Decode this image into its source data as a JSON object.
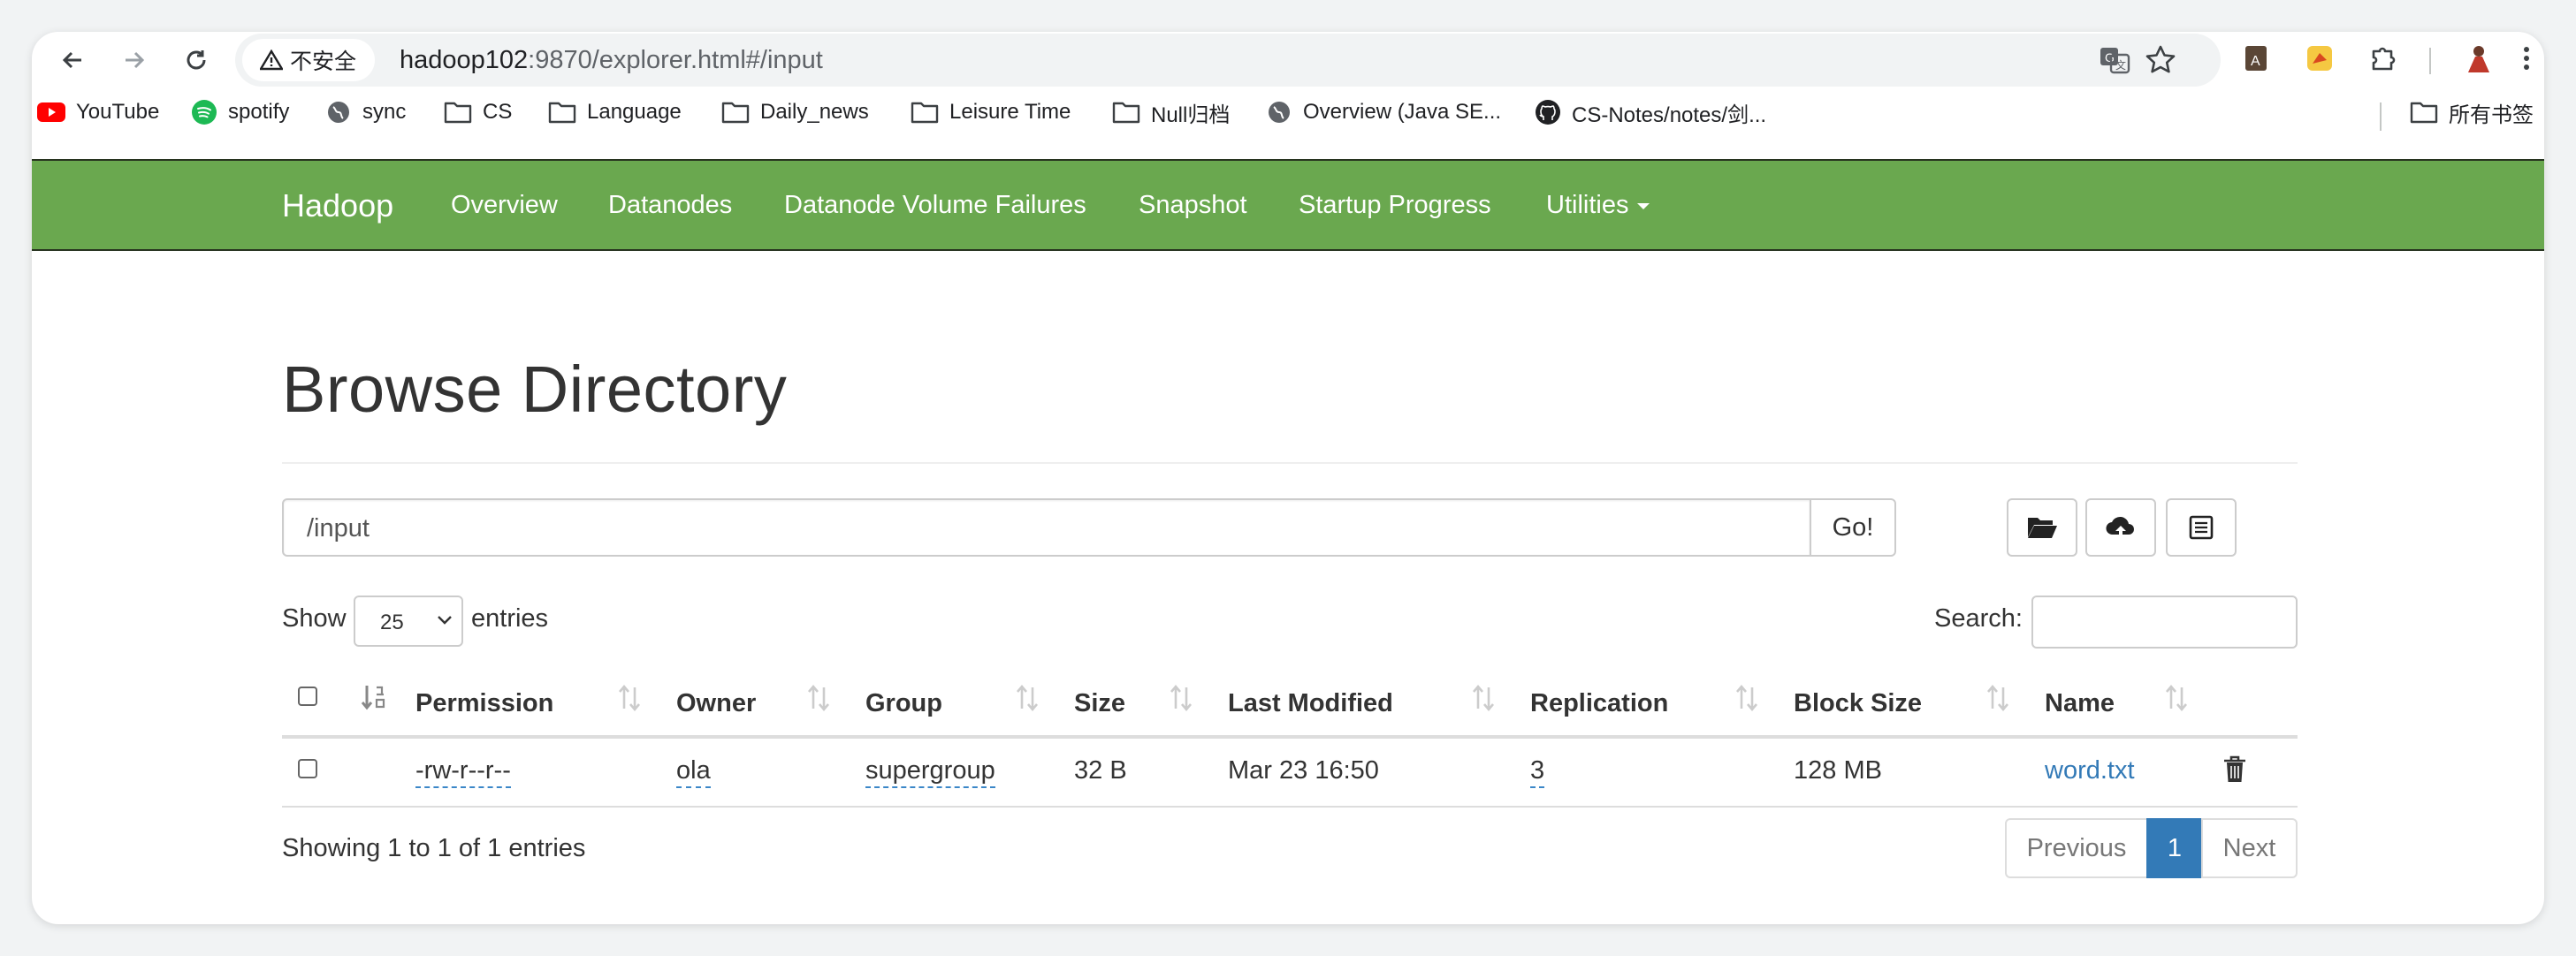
{
  "browser": {
    "security_label": "不安全",
    "url_host": "hadoop102",
    "url_rest": ":9870/explorer.html#/input"
  },
  "bookmarks": [
    {
      "label": "YouTube",
      "icon": "youtube-icon"
    },
    {
      "label": "spotify",
      "icon": "spotify-icon"
    },
    {
      "label": "sync",
      "icon": "globe-icon"
    },
    {
      "label": "CS",
      "icon": "folder-icon"
    },
    {
      "label": "Language",
      "icon": "folder-icon"
    },
    {
      "label": "Daily_news",
      "icon": "folder-icon"
    },
    {
      "label": "Leisure Time",
      "icon": "folder-icon"
    },
    {
      "label": "Null归档",
      "icon": "folder-icon"
    },
    {
      "label": "Overview (Java SE...",
      "icon": "globe-icon"
    },
    {
      "label": "CS-Notes/notes/剑...",
      "icon": "github-icon"
    },
    {
      "label": "所有书签",
      "icon": "folder-icon"
    }
  ],
  "navbar": {
    "brand": "Hadoop",
    "links": [
      "Overview",
      "Datanodes",
      "Datanode Volume Failures",
      "Snapshot",
      "Startup Progress",
      "Utilities"
    ],
    "bg_color": "#6aa84f"
  },
  "main": {
    "title": "Browse Directory",
    "path_value": "/input",
    "go_label": "Go!",
    "show_label": "Show",
    "entries_select": "25",
    "entries_label": "entries",
    "search_label": "Search:",
    "search_value": ""
  },
  "table": {
    "columns": [
      "Permission",
      "Owner",
      "Group",
      "Size",
      "Last Modified",
      "Replication",
      "Block Size",
      "Name"
    ],
    "rows": [
      {
        "permission": "-rw-r--r--",
        "owner": "ola",
        "group": "supergroup",
        "size": "32 B",
        "last_modified": "Mar 23 16:50",
        "replication": "3",
        "block_size": "128 MB",
        "name": "word.txt"
      }
    ],
    "info": "Showing 1 to 1 of 1 entries"
  },
  "pagination": {
    "previous": "Previous",
    "current": "1",
    "next": "Next",
    "active_color": "#337ab7"
  }
}
